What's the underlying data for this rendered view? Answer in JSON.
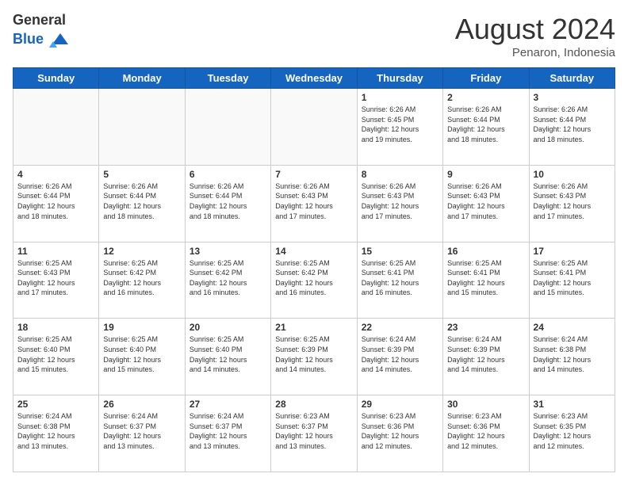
{
  "header": {
    "logo_general": "General",
    "logo_blue": "Blue",
    "month_year": "August 2024",
    "location": "Penaron, Indonesia"
  },
  "calendar": {
    "days_of_week": [
      "Sunday",
      "Monday",
      "Tuesday",
      "Wednesday",
      "Thursday",
      "Friday",
      "Saturday"
    ],
    "weeks": [
      [
        {
          "day": "",
          "info": ""
        },
        {
          "day": "",
          "info": ""
        },
        {
          "day": "",
          "info": ""
        },
        {
          "day": "",
          "info": ""
        },
        {
          "day": "1",
          "info": "Sunrise: 6:26 AM\nSunset: 6:45 PM\nDaylight: 12 hours\nand 19 minutes."
        },
        {
          "day": "2",
          "info": "Sunrise: 6:26 AM\nSunset: 6:44 PM\nDaylight: 12 hours\nand 18 minutes."
        },
        {
          "day": "3",
          "info": "Sunrise: 6:26 AM\nSunset: 6:44 PM\nDaylight: 12 hours\nand 18 minutes."
        }
      ],
      [
        {
          "day": "4",
          "info": "Sunrise: 6:26 AM\nSunset: 6:44 PM\nDaylight: 12 hours\nand 18 minutes."
        },
        {
          "day": "5",
          "info": "Sunrise: 6:26 AM\nSunset: 6:44 PM\nDaylight: 12 hours\nand 18 minutes."
        },
        {
          "day": "6",
          "info": "Sunrise: 6:26 AM\nSunset: 6:44 PM\nDaylight: 12 hours\nand 18 minutes."
        },
        {
          "day": "7",
          "info": "Sunrise: 6:26 AM\nSunset: 6:43 PM\nDaylight: 12 hours\nand 17 minutes."
        },
        {
          "day": "8",
          "info": "Sunrise: 6:26 AM\nSunset: 6:43 PM\nDaylight: 12 hours\nand 17 minutes."
        },
        {
          "day": "9",
          "info": "Sunrise: 6:26 AM\nSunset: 6:43 PM\nDaylight: 12 hours\nand 17 minutes."
        },
        {
          "day": "10",
          "info": "Sunrise: 6:26 AM\nSunset: 6:43 PM\nDaylight: 12 hours\nand 17 minutes."
        }
      ],
      [
        {
          "day": "11",
          "info": "Sunrise: 6:25 AM\nSunset: 6:43 PM\nDaylight: 12 hours\nand 17 minutes."
        },
        {
          "day": "12",
          "info": "Sunrise: 6:25 AM\nSunset: 6:42 PM\nDaylight: 12 hours\nand 16 minutes."
        },
        {
          "day": "13",
          "info": "Sunrise: 6:25 AM\nSunset: 6:42 PM\nDaylight: 12 hours\nand 16 minutes."
        },
        {
          "day": "14",
          "info": "Sunrise: 6:25 AM\nSunset: 6:42 PM\nDaylight: 12 hours\nand 16 minutes."
        },
        {
          "day": "15",
          "info": "Sunrise: 6:25 AM\nSunset: 6:41 PM\nDaylight: 12 hours\nand 16 minutes."
        },
        {
          "day": "16",
          "info": "Sunrise: 6:25 AM\nSunset: 6:41 PM\nDaylight: 12 hours\nand 15 minutes."
        },
        {
          "day": "17",
          "info": "Sunrise: 6:25 AM\nSunset: 6:41 PM\nDaylight: 12 hours\nand 15 minutes."
        }
      ],
      [
        {
          "day": "18",
          "info": "Sunrise: 6:25 AM\nSunset: 6:40 PM\nDaylight: 12 hours\nand 15 minutes."
        },
        {
          "day": "19",
          "info": "Sunrise: 6:25 AM\nSunset: 6:40 PM\nDaylight: 12 hours\nand 15 minutes."
        },
        {
          "day": "20",
          "info": "Sunrise: 6:25 AM\nSunset: 6:40 PM\nDaylight: 12 hours\nand 14 minutes."
        },
        {
          "day": "21",
          "info": "Sunrise: 6:25 AM\nSunset: 6:39 PM\nDaylight: 12 hours\nand 14 minutes."
        },
        {
          "day": "22",
          "info": "Sunrise: 6:24 AM\nSunset: 6:39 PM\nDaylight: 12 hours\nand 14 minutes."
        },
        {
          "day": "23",
          "info": "Sunrise: 6:24 AM\nSunset: 6:39 PM\nDaylight: 12 hours\nand 14 minutes."
        },
        {
          "day": "24",
          "info": "Sunrise: 6:24 AM\nSunset: 6:38 PM\nDaylight: 12 hours\nand 14 minutes."
        }
      ],
      [
        {
          "day": "25",
          "info": "Sunrise: 6:24 AM\nSunset: 6:38 PM\nDaylight: 12 hours\nand 13 minutes."
        },
        {
          "day": "26",
          "info": "Sunrise: 6:24 AM\nSunset: 6:37 PM\nDaylight: 12 hours\nand 13 minutes."
        },
        {
          "day": "27",
          "info": "Sunrise: 6:24 AM\nSunset: 6:37 PM\nDaylight: 12 hours\nand 13 minutes."
        },
        {
          "day": "28",
          "info": "Sunrise: 6:23 AM\nSunset: 6:37 PM\nDaylight: 12 hours\nand 13 minutes."
        },
        {
          "day": "29",
          "info": "Sunrise: 6:23 AM\nSunset: 6:36 PM\nDaylight: 12 hours\nand 12 minutes."
        },
        {
          "day": "30",
          "info": "Sunrise: 6:23 AM\nSunset: 6:36 PM\nDaylight: 12 hours\nand 12 minutes."
        },
        {
          "day": "31",
          "info": "Sunrise: 6:23 AM\nSunset: 6:35 PM\nDaylight: 12 hours\nand 12 minutes."
        }
      ]
    ]
  }
}
